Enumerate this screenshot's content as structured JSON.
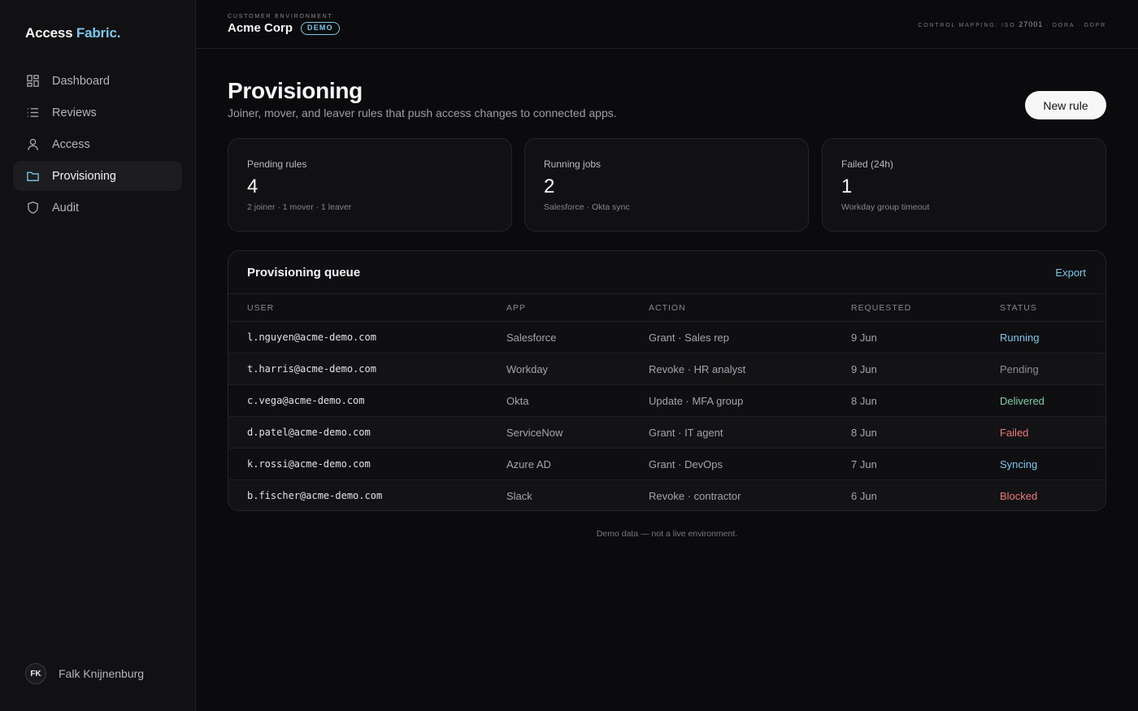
{
  "brand": {
    "name": "Access",
    "accent": "Fabric."
  },
  "nav": [
    {
      "label": "Dashboard",
      "icon": "dashboard-icon",
      "active": false
    },
    {
      "label": "Reviews",
      "icon": "list-icon",
      "active": false
    },
    {
      "label": "Access",
      "icon": "user-icon",
      "active": false
    },
    {
      "label": "Provisioning",
      "icon": "folder-icon",
      "active": true
    },
    {
      "label": "Audit",
      "icon": "shield-icon",
      "active": false
    }
  ],
  "user": {
    "initials": "FK",
    "name": "Falk Knijnenburg"
  },
  "topbar": {
    "env_label": "CUSTOMER ENVIRONMENT",
    "env_name": "Acme Corp",
    "badge": "DEMO",
    "control_prefix": "CONTROL MAPPING: ISO",
    "control_iso": "27001",
    "control_suffix": "· DORA · GDPR"
  },
  "page": {
    "title": "Provisioning",
    "subtitle": "Joiner, mover, and leaver rules that push access changes to connected apps.",
    "new_rule_label": "New rule"
  },
  "cards": [
    {
      "label": "Pending rules",
      "value": "4",
      "note": "2 joiner · 1 mover · 1 leaver"
    },
    {
      "label": "Running jobs",
      "value": "2",
      "note": "Salesforce · Okta sync"
    },
    {
      "label": "Failed (24h)",
      "value": "1",
      "note": "Workday group timeout"
    }
  ],
  "queue": {
    "title": "Provisioning queue",
    "export_label": "Export",
    "columns": [
      "USER",
      "APP",
      "ACTION",
      "REQUESTED",
      "STATUS"
    ],
    "rows": [
      {
        "user": "l.nguyen@acme-demo.com",
        "app": "Salesforce",
        "action": "Grant · Sales rep",
        "requested": "9 Jun",
        "status": "Running"
      },
      {
        "user": "t.harris@acme-demo.com",
        "app": "Workday",
        "action": "Revoke · HR analyst",
        "requested": "9 Jun",
        "status": "Pending"
      },
      {
        "user": "c.vega@acme-demo.com",
        "app": "Okta",
        "action": "Update · MFA group",
        "requested": "8 Jun",
        "status": "Delivered"
      },
      {
        "user": "d.patel@acme-demo.com",
        "app": "ServiceNow",
        "action": "Grant · IT agent",
        "requested": "8 Jun",
        "status": "Failed"
      },
      {
        "user": "k.rossi@acme-demo.com",
        "app": "Azure AD",
        "action": "Grant · DevOps",
        "requested": "7 Jun",
        "status": "Syncing"
      },
      {
        "user": "b.fischer@acme-demo.com",
        "app": "Slack",
        "action": "Revoke · contractor",
        "requested": "6 Jun",
        "status": "Blocked"
      }
    ]
  },
  "footnote": "Demo data — not a live environment.",
  "colors": {
    "accent": "#7cc7ea",
    "success": "#7fcfa7",
    "danger": "#ec7a7a",
    "muted": "#8c8c92"
  }
}
